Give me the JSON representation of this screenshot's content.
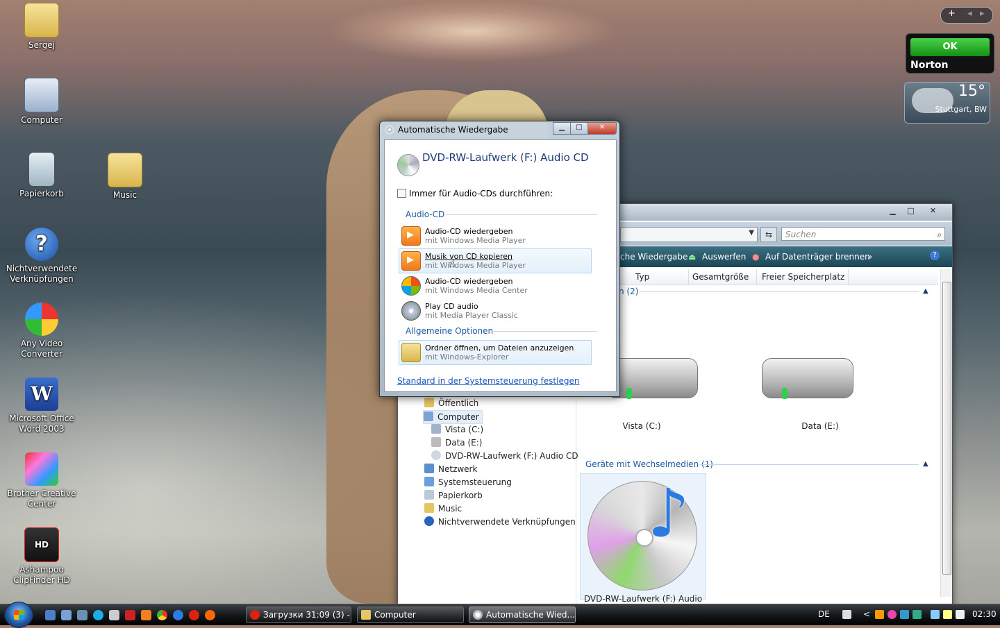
{
  "desktop": {
    "icons": [
      {
        "label": "Sergej",
        "icon": "folder-icon"
      },
      {
        "label": "Computer",
        "icon": "computer-icon"
      },
      {
        "label": "Papierkorb",
        "icon": "recycle-bin-icon"
      },
      {
        "label": "Music",
        "icon": "music-folder-icon"
      },
      {
        "label": "Nichtverwendete Verknüpfungen",
        "icon": "help-icon"
      },
      {
        "label": "Any Video Converter",
        "icon": "video-converter-icon"
      },
      {
        "label": "Microsoft Office Word 2003",
        "icon": "word-icon"
      },
      {
        "label": "Brother Creative Center",
        "icon": "brother-icon"
      },
      {
        "label": "Ashampoo ClipFinder HD",
        "icon": "clipfinder-icon"
      }
    ]
  },
  "gadgets": {
    "bar_add": "+",
    "bar_prev": "◂",
    "bar_next": "▸",
    "norton_status": "OK",
    "norton_brand": "Norton",
    "weather_temp": "15°",
    "weather_city": "Stuttgart, BW"
  },
  "autoplay": {
    "title": "Automatische Wiedergabe",
    "heading": "DVD-RW-Laufwerk (F:) Audio CD",
    "always_checkbox": "Immer für Audio-CDs durchführen:",
    "section_audio": "Audio-CD",
    "items": [
      {
        "line1": "Audio-CD wiedergeben",
        "line2": "mit Windows Media Player",
        "icon": "media-player-icon"
      },
      {
        "line1": "Musik von CD kopieren",
        "line2": "mit Windows Media Player",
        "icon": "media-player-icon"
      },
      {
        "line1": "Audio-CD wiedergeben",
        "line2": "mit Windows Media Center",
        "icon": "media-center-icon"
      },
      {
        "line1": "Play CD audio",
        "line2": "mit Media Player Classic",
        "icon": "media-player-classic-icon"
      }
    ],
    "section_general": "Allgemeine Optionen",
    "open_folder": {
      "line1": "Ordner öffnen, um Dateien anzuzeigen",
      "line2": "mit Windows-Explorer",
      "icon": "folder-icon"
    },
    "link": "Standard in der Systemsteuerung festlegen",
    "btn_minimize": "▁",
    "btn_maximize": "□",
    "btn_close": "✕"
  },
  "explorer": {
    "btn_minimize": "▁",
    "btn_maximize": "□",
    "btn_close": "✕",
    "search_placeholder": "Suchen",
    "toolbar": {
      "playback": "che Wiedergabe",
      "eject": "Auswerfen",
      "burn": "Auf Datenträger brennen",
      "more": "»",
      "help": "?"
    },
    "columns": [
      "Typ",
      "Gesamtgröße",
      "Freier Speicherplatz"
    ],
    "group_drives": "n (2)",
    "drives": [
      {
        "label": "Vista (C:)"
      },
      {
        "label": "Data (E:)"
      }
    ],
    "group_removable": "Geräte mit Wechselmedien (1)",
    "removable": {
      "label": "DVD-RW-Laufwerk (F:) Audio CD"
    },
    "nav": [
      {
        "label": "Öffentlich",
        "icon": "folder-icon"
      },
      {
        "label": "Computer",
        "icon": "computer-icon"
      },
      {
        "label": "Vista (C:)",
        "icon": "drive-icon"
      },
      {
        "label": "Data (E:)",
        "icon": "drive-icon"
      },
      {
        "label": "DVD-RW-Laufwerk (F:) Audio CD",
        "icon": "cd-icon"
      },
      {
        "label": "Netzwerk",
        "icon": "network-icon"
      },
      {
        "label": "Systemsteuerung",
        "icon": "control-panel-icon"
      },
      {
        "label": "Papierkorb",
        "icon": "recycle-bin-icon"
      },
      {
        "label": "Music",
        "icon": "folder-icon"
      },
      {
        "label": "Nichtverwendete Verknüpfungen",
        "icon": "help-icon"
      }
    ]
  },
  "taskbar": {
    "tasks": [
      {
        "label": "Загрузки 31:09 (3) - ..."
      },
      {
        "label": "Computer"
      },
      {
        "label": "Automatische Wied..."
      }
    ],
    "language": "DE",
    "clock": "02:30",
    "tray_arrow": "<"
  }
}
